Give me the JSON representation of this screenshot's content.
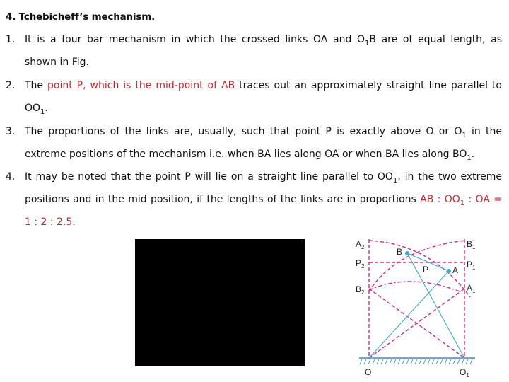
{
  "title": "4. Tchebicheff’s mechanism.",
  "items": [
    {
      "num": "1.",
      "line1": [
        "It is a four bar mechanism in which the crossed links OA and O",
        "1",
        "B are of equal length, as"
      ],
      "line2": "shown in Fig."
    },
    {
      "num": "2.",
      "line1_pre": "The ",
      "line1_red": "point P, which is the mid-point of AB",
      "line1_post": " traces out an approximately straight line parallel to",
      "line2": [
        "OO",
        "1",
        "."
      ]
    },
    {
      "num": "3.",
      "line1": [
        "The proportions of the links are, usually, such that point P is exactly above O or O",
        "1",
        " in the"
      ],
      "line2": [
        "extreme positions of the mechanism i.e. when BA lies along OA or when BA lies along BO",
        "1",
        "."
      ]
    },
    {
      "num": "4.",
      "line1": [
        "It may be noted that the point P will lie on a straight line parallel to OO",
        "1",
        ", in the two extreme"
      ],
      "line2_pre": "positions and in the mid position, if the lengths of the links are in proportions ",
      "line2_red": [
        "AB : OO",
        "1",
        " : OA ="
      ],
      "line3_red": "1 : 2 : 2.5",
      "line3_post": "."
    }
  ],
  "diagram": {
    "labels": {
      "A2": [
        "A",
        "2"
      ],
      "B1": [
        "B",
        "1"
      ],
      "P2": [
        "P",
        "2"
      ],
      "P1": [
        "P",
        "1"
      ],
      "B2": [
        "B",
        "2"
      ],
      "A1": [
        "A",
        "1"
      ],
      "B": "B",
      "A": "A",
      "P": "P",
      "O": "O",
      "O1": [
        "O",
        "1"
      ]
    },
    "colors": {
      "construction": "#d0288a",
      "links": "#3aa9d0",
      "ground": "#3a8fc0"
    }
  },
  "redacted_image": {
    "color": "#000000"
  }
}
